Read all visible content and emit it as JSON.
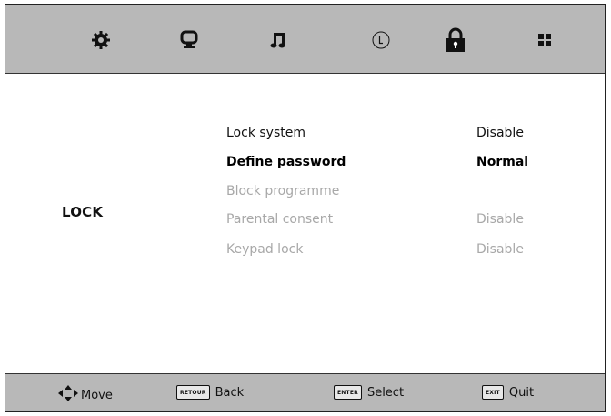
{
  "top_tabs": [
    {
      "id": "picture",
      "icon": "gear-icon"
    },
    {
      "id": "screen",
      "icon": "monitor-icon"
    },
    {
      "id": "sound",
      "icon": "music-note-icon"
    },
    {
      "id": "time",
      "icon": "clock-icon"
    },
    {
      "id": "lock",
      "icon": "padlock-icon",
      "active": true
    },
    {
      "id": "setup",
      "icon": "grid-icon"
    }
  ],
  "page": {
    "section_title": "LOCK"
  },
  "menu": {
    "items": [
      {
        "label": "Lock system",
        "value": "Disable",
        "state": "enabled"
      },
      {
        "label": "Define password",
        "value": "Normal",
        "state": "selected"
      },
      {
        "label": "Block programme",
        "value": "",
        "state": "disabled"
      },
      {
        "label": "Parental consent",
        "value": "Disable",
        "state": "disabled"
      },
      {
        "label": "Keypad lock",
        "value": "Disable",
        "state": "disabled"
      }
    ]
  },
  "footer": {
    "move_label": "Move",
    "back_key": "RETOUR",
    "back_label": "Back",
    "select_key": "ENTER",
    "select_label": "Select",
    "exit_key": "EXIT",
    "quit_label": "Quit"
  },
  "colors": {
    "bar_background": "#b8b8b8",
    "disabled_text": "#a8a8a8",
    "text": "#111111"
  }
}
